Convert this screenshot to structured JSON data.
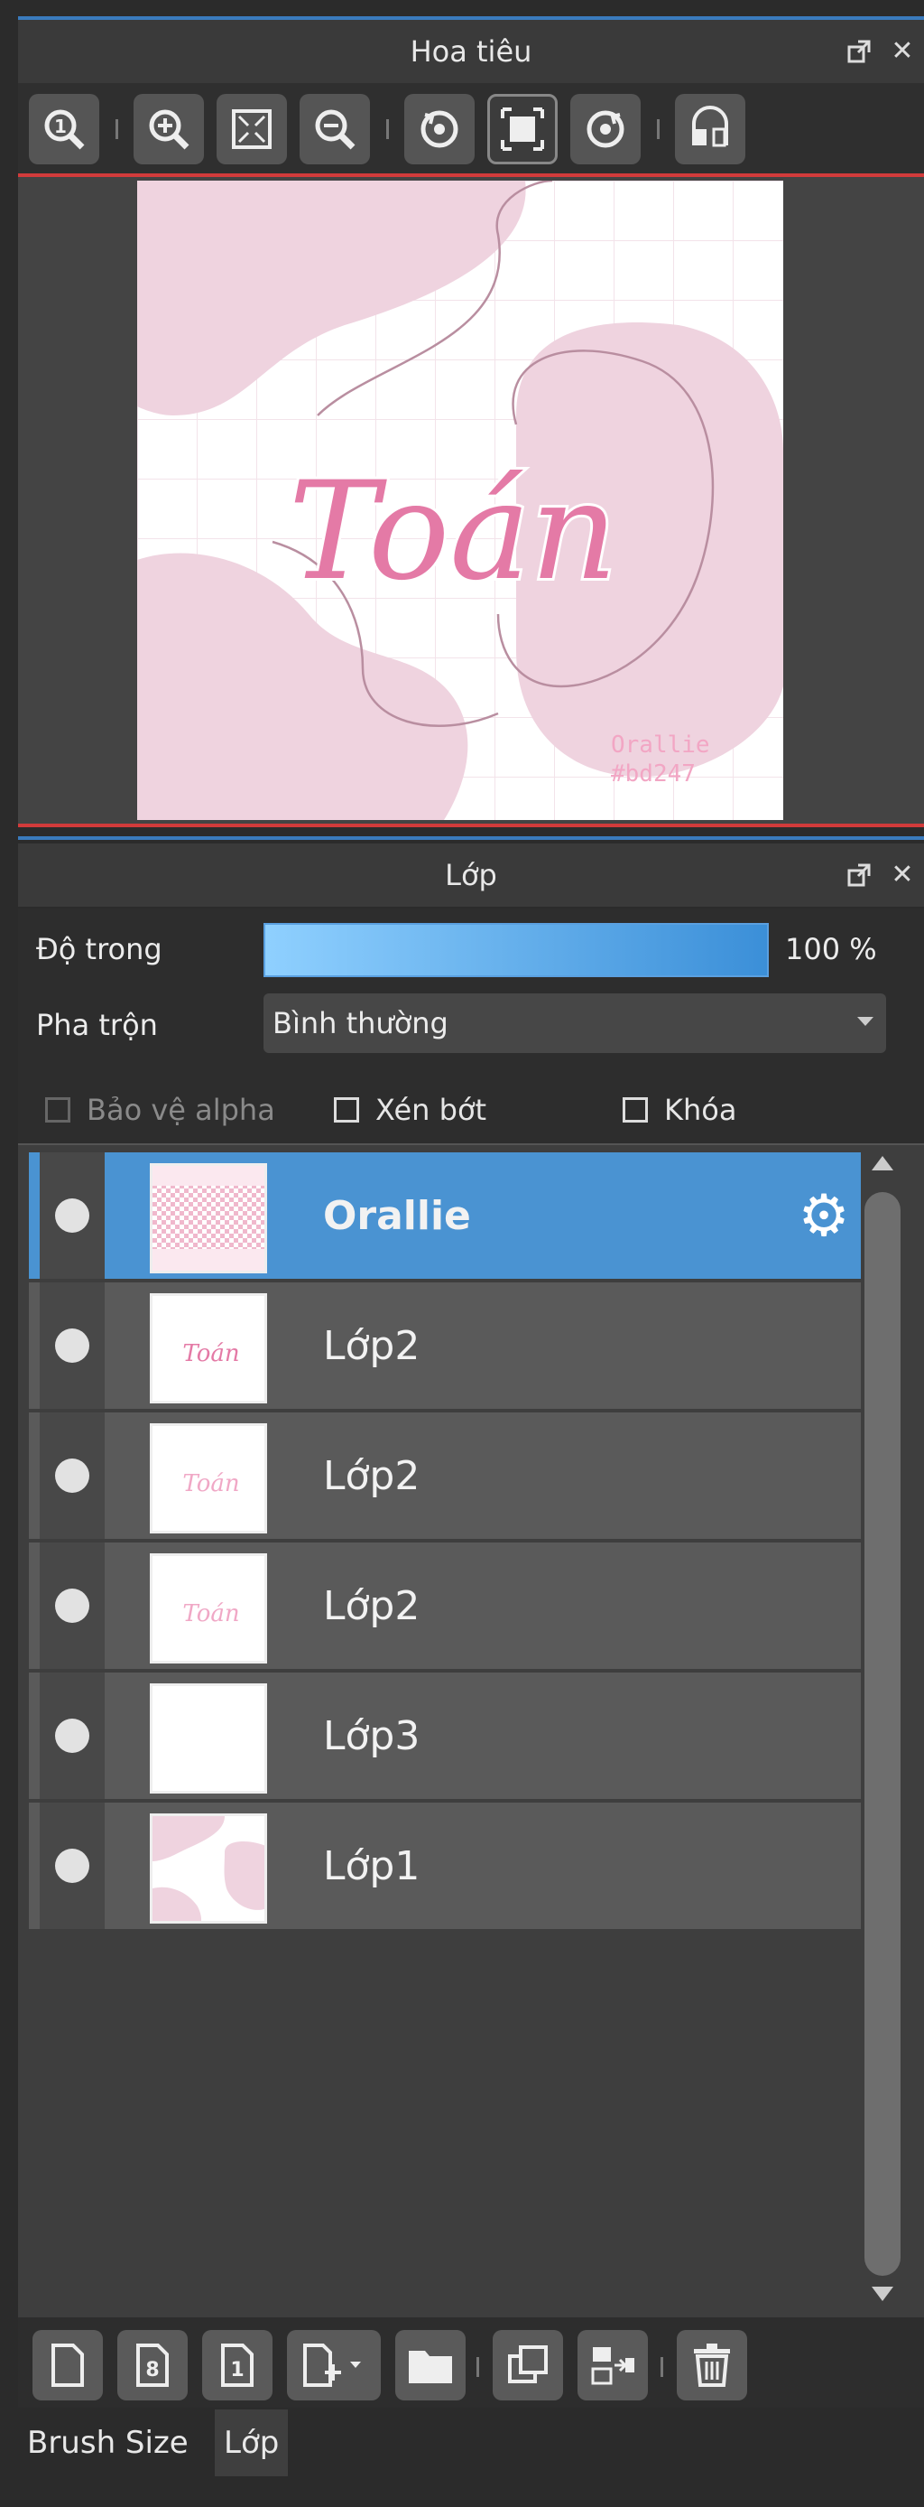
{
  "navigator": {
    "title": "Hoa tiêu",
    "toolbar": {
      "icons": [
        "zoom-actual-icon",
        "zoom-in-icon",
        "fit-screen-icon",
        "zoom-out-icon",
        "rotate-left-icon",
        "fit-canvas-icon",
        "rotate-right-icon",
        "flip-horizontal-icon"
      ]
    },
    "canvas": {
      "title_text": "Toán",
      "signature_line1": "Orallie",
      "signature_line2": "#bd247",
      "pink_color": "#efd3df",
      "stroke_color": "#e47aa6"
    }
  },
  "layer_panel": {
    "title": "Lớp",
    "opacity_label": "Độ trong",
    "opacity_value": "100 %",
    "blend_label": "Pha trộn",
    "blend_value": "Bình thường",
    "protect_alpha_label": "Bảo vệ alpha",
    "clipping_label": "Xén bớt",
    "lock_label": "Khóa",
    "layers": [
      {
        "name": "Orallie",
        "selected": true
      },
      {
        "name": "Lớp2",
        "selected": false
      },
      {
        "name": "Lớp2",
        "selected": false
      },
      {
        "name": "Lớp2",
        "selected": false
      },
      {
        "name": "Lớp3",
        "selected": false
      },
      {
        "name": "Lớp1",
        "selected": false
      }
    ]
  },
  "bottom_tabs": {
    "brush_size": "Brush Size",
    "layer": "Lớp"
  },
  "colors": {
    "accent_blue": "#4a93d2",
    "panel_line": "#3a7bbd",
    "nav_border": "#d23b3b"
  }
}
